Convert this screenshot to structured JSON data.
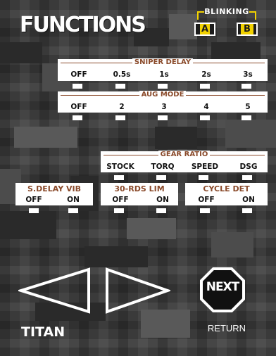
{
  "header": {
    "title": "FUNCTIONS"
  },
  "blinking": {
    "label": "BLINKING",
    "option_a": "A",
    "option_b": "B"
  },
  "sniper_delay": {
    "title": "SNIPER DELAY",
    "options": [
      "OFF",
      "0.5s",
      "1s",
      "2s",
      "3s"
    ]
  },
  "aug_mode": {
    "title": "AUG MODE",
    "options": [
      "OFF",
      "2",
      "3",
      "4",
      "5"
    ]
  },
  "gear_ratio": {
    "title": "GEAR RATIO",
    "options": [
      "STOCK",
      "TORQ",
      "SPEED",
      "DSG"
    ]
  },
  "s_delay_vib": {
    "title": "S.DELAY VIB",
    "options": [
      "OFF",
      "ON"
    ]
  },
  "rds_lim": {
    "title": "30-RDS LIM",
    "options": [
      "OFF",
      "ON"
    ]
  },
  "cycle_det": {
    "title": "CYCLE DET",
    "options": [
      "OFF",
      "ON"
    ]
  },
  "nav": {
    "next_label": "NEXT",
    "return_label": "RETURN"
  },
  "brand": {
    "name": "TITAN"
  },
  "colors": {
    "accent": "#f2d200",
    "panel_border": "#8a4a2a",
    "panel_bg": "#ffffff"
  },
  "icons": {
    "prev": "triangle-left-icon",
    "next_page": "triangle-right-icon",
    "next": "octagon-next-icon"
  }
}
